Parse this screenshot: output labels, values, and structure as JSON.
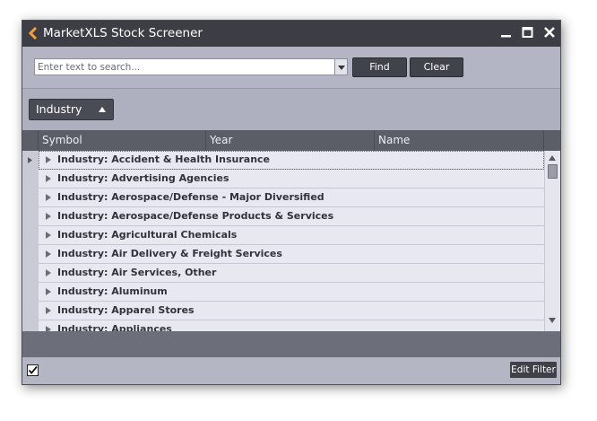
{
  "window": {
    "title": "MarketXLS Stock Screener",
    "logo_icon": "chevron-left-icon",
    "controls": [
      "minimize-icon",
      "maximize-icon",
      "close-icon"
    ]
  },
  "search": {
    "placeholder": "Enter text to search...",
    "value": "",
    "find_label": "Find",
    "clear_label": "Clear"
  },
  "grouping": {
    "chip_label": "Industry",
    "sort_direction": "ascending"
  },
  "grid": {
    "columns": [
      "Symbol",
      "Year",
      "Name"
    ],
    "rows": [
      "Industry: Accident & Health Insurance",
      "Industry: Advertising Agencies",
      "Industry: Aerospace/Defense - Major Diversified",
      "Industry: Aerospace/Defense Products & Services",
      "Industry: Agricultural Chemicals",
      "Industry: Air Delivery & Freight Services",
      "Industry: Air Services, Other",
      "Industry: Aluminum",
      "Industry: Apparel Stores",
      "Industry: Appliances"
    ]
  },
  "status": {
    "edit_filter_label": "Edit Filter",
    "filter_enabled": true
  },
  "colors": {
    "titlebar": "#3d3e45",
    "body": "#aeb0c0",
    "header": "#5b5d67",
    "accent": "#f39c3a"
  }
}
